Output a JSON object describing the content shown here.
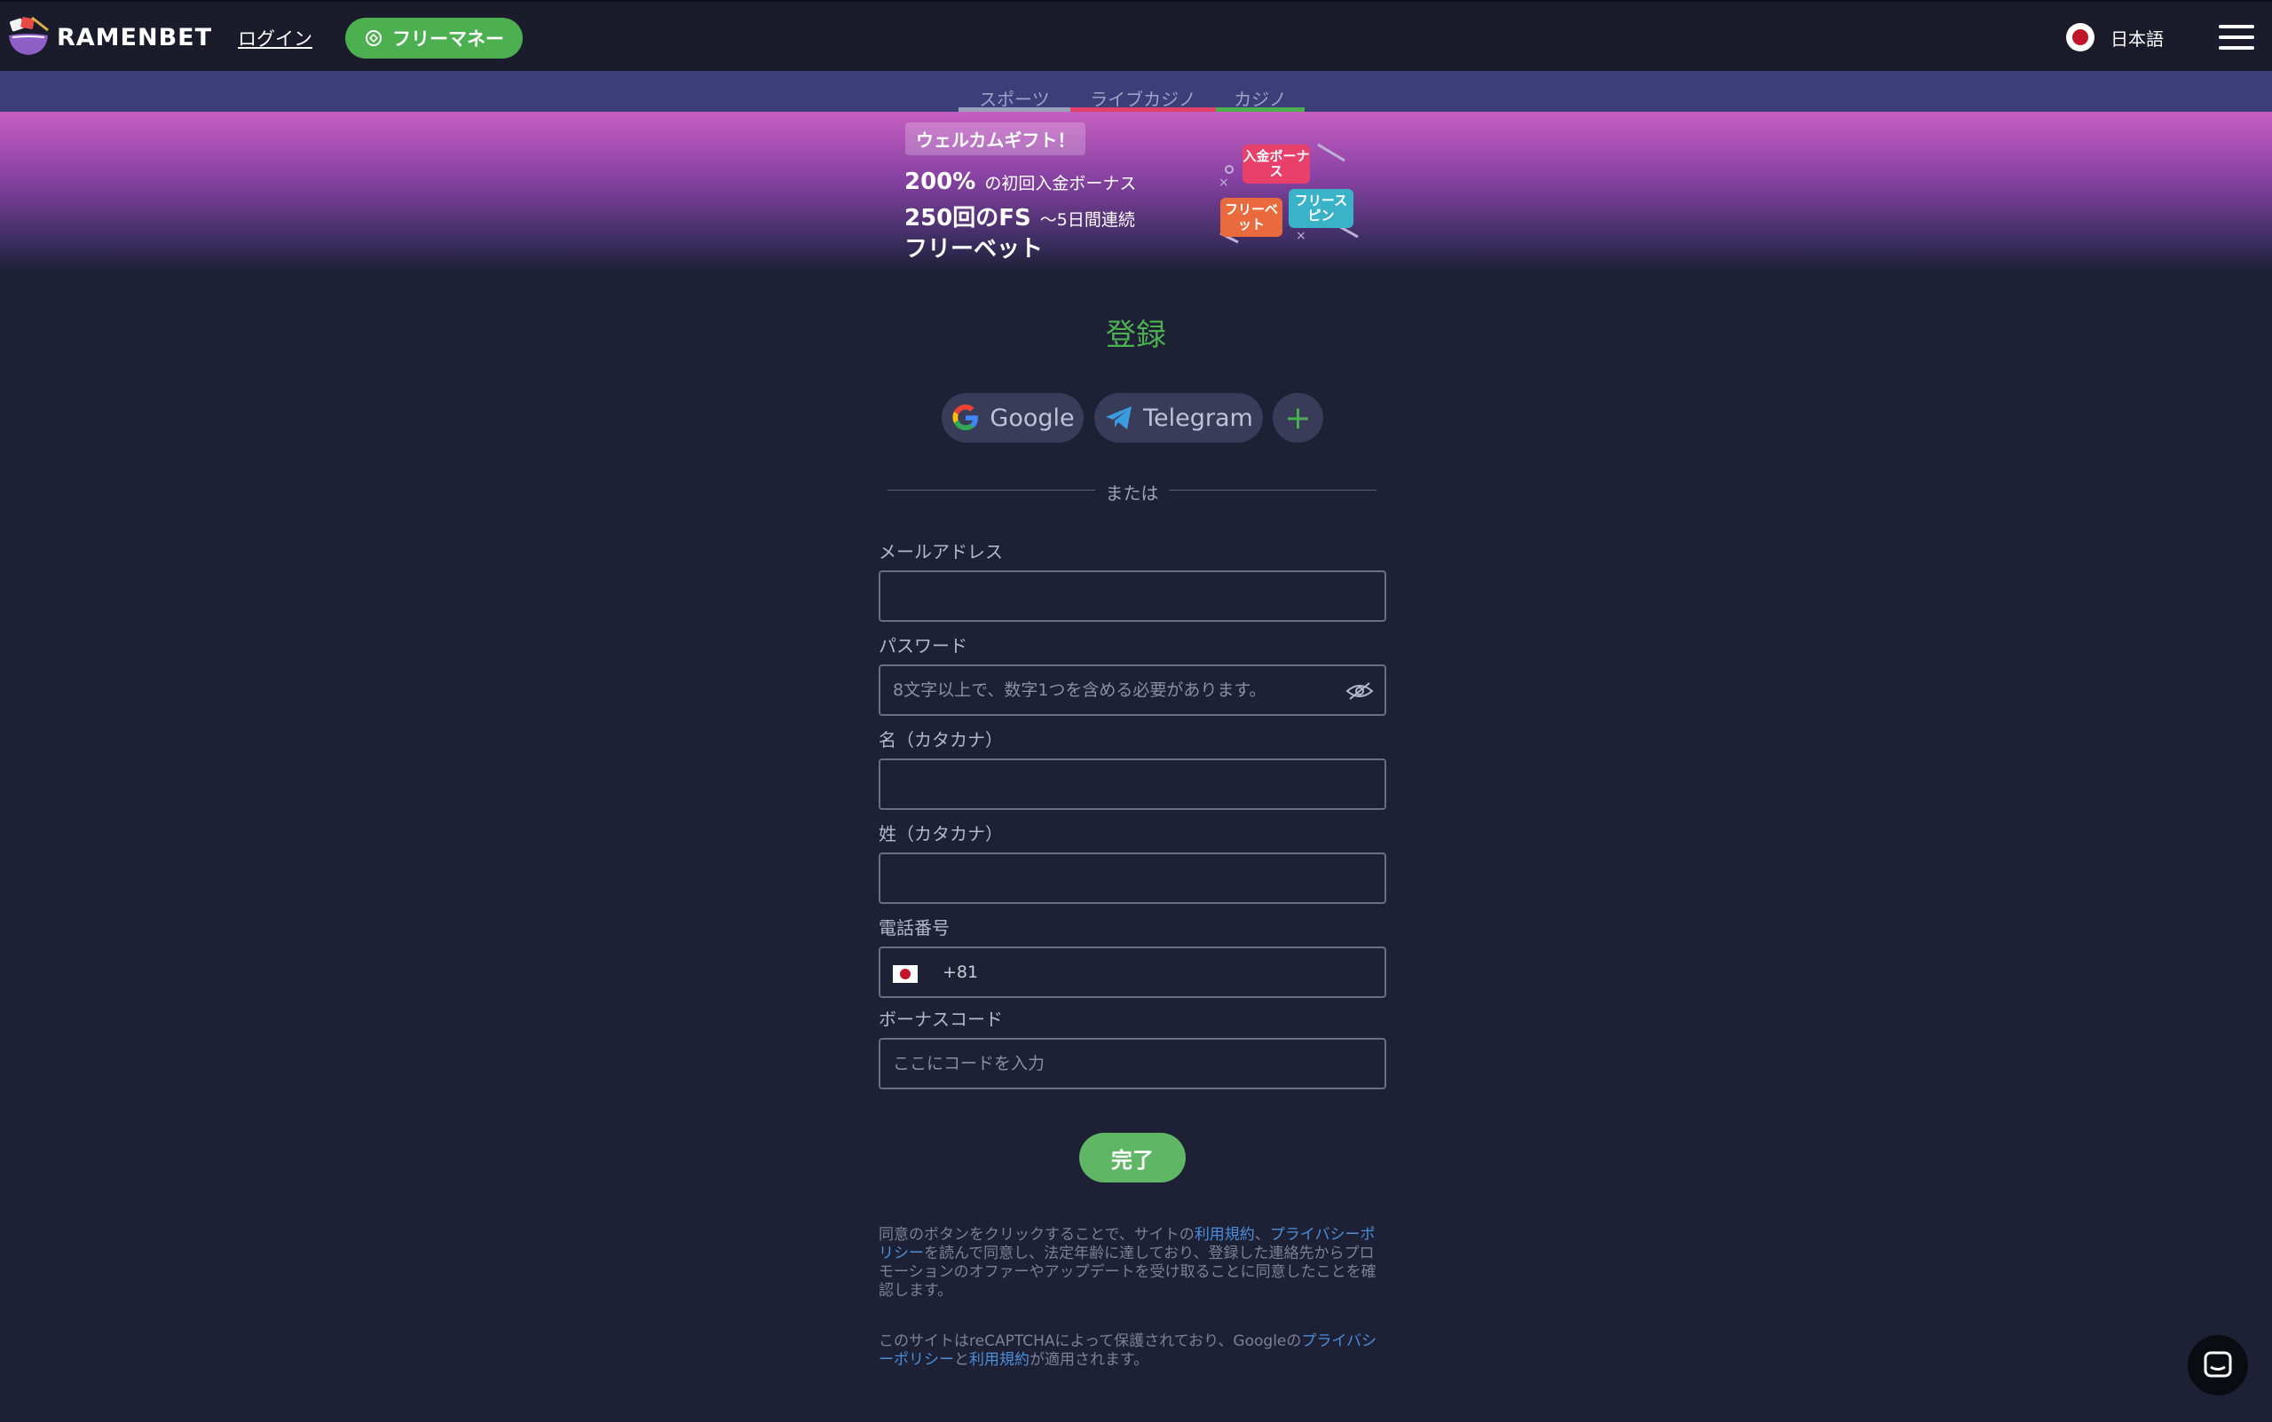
{
  "header": {
    "brand": "RAMENBET",
    "login_label": "ログイン",
    "free_money_label": "フリーマネー",
    "language_label": "日本語"
  },
  "categories": [
    {
      "label": "スポーツ",
      "color": "#9aa0ba"
    },
    {
      "label": "ライブカジノ",
      "color": "#e0406a"
    },
    {
      "label": "カジノ",
      "color": "#4caf50"
    }
  ],
  "promo": {
    "badge": "ウェルカムギフト！",
    "line1_big": "200%",
    "line1_small": "の初回入金ボーナス",
    "line2_big": "250回のFS",
    "line2_small": "〜5日間連続",
    "line3_big": "フリーベット",
    "tiles": [
      "入金ボーナス",
      "フリーベット",
      "フリースピン"
    ]
  },
  "form": {
    "title": "登録",
    "social": {
      "google": "Google",
      "telegram": "Telegram"
    },
    "or_text": "または",
    "email_label": "メールアドレス",
    "email_value": "",
    "password_label": "パスワード",
    "password_placeholder": "8文字以上で、数字1つを含める必要があります。",
    "first_name_label": "名（カタカナ）",
    "last_name_label": "姓（カタカナ）",
    "phone_label": "電話番号",
    "phone_code": "+81",
    "bonus_label": "ボーナスコード",
    "bonus_placeholder": "ここにコードを入力",
    "submit_label": "完了"
  },
  "legal": {
    "terms_prefix": "同意のボタンをクリックすることで、サイトの",
    "terms_link": "利用規約",
    "terms_sep": "、",
    "privacy_link": "プライバシーポリシー",
    "terms_suffix": "を読んで同意し、法定年齢に達しており、登録した連絡先からプロモーションのオファーやアップデートを受け取ることに同意したことを確認します。",
    "recaptcha_prefix": "このサイトはreCAPTCHAによって保護されており、Googleの",
    "recaptcha_privacy": "プライバシーポリシー",
    "recaptcha_and": "と",
    "recaptcha_terms": "利用規約",
    "recaptcha_suffix": "が適用されます。"
  },
  "colors": {
    "accent": "#4caf50",
    "link": "#4b8fd9",
    "background": "#1e2036"
  }
}
